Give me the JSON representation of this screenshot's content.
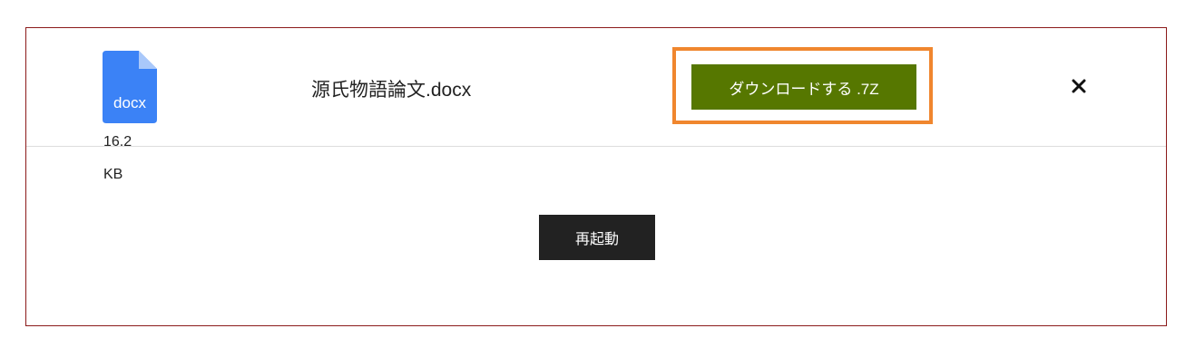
{
  "file": {
    "icon": "docx-file-icon",
    "icon_label": "docx",
    "icon_color": "#3b82f6",
    "size_text": "16.2 KB",
    "name": "源氏物語論文.docx"
  },
  "actions": {
    "download_label": "ダウンロードする .7Z",
    "download_color": "#567700",
    "highlight_color": "#f0862e",
    "close_icon": "close-icon",
    "restart_label": "再起動"
  }
}
